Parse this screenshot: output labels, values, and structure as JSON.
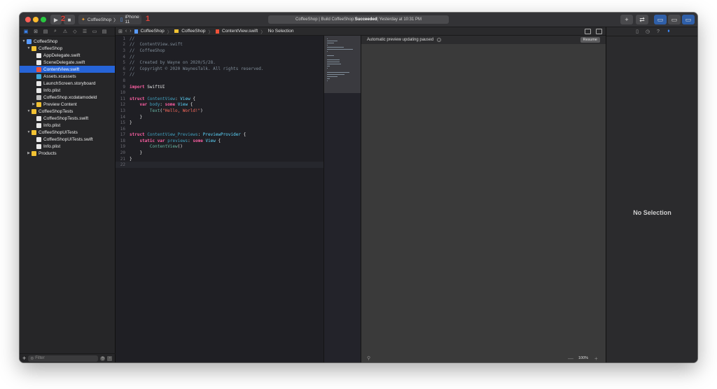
{
  "toolbar": {
    "marker_2": "2",
    "marker_1": "1",
    "scheme_name": "CoffeeShop",
    "scheme_sep": "〉",
    "device_name": "iPhone 11",
    "activity_prefix": "CoffeeShop | Build CoffeeShop: ",
    "activity_status": "Succeeded",
    "activity_suffix": " | Yesterday at 10:31 PM",
    "run_glyph": "▶",
    "stop_glyph": "■"
  },
  "navigator": {
    "items": [
      {
        "label": "CoffeeShop",
        "indent": 0,
        "disclosure": "▼",
        "icon": "proj"
      },
      {
        "label": "CoffeeShop",
        "indent": 1,
        "disclosure": "▼",
        "icon": "folder"
      },
      {
        "label": "AppDelegate.swift",
        "indent": 2,
        "disclosure": "",
        "icon": "file"
      },
      {
        "label": "SceneDelegate.swift",
        "indent": 2,
        "disclosure": "",
        "icon": "file"
      },
      {
        "label": "ContentView.swift",
        "indent": 2,
        "disclosure": "",
        "icon": "swift",
        "selected": true
      },
      {
        "label": "Assets.xcassets",
        "indent": 2,
        "disclosure": "",
        "icon": "assets"
      },
      {
        "label": "LaunchScreen.storyboard",
        "indent": 2,
        "disclosure": "",
        "icon": "file"
      },
      {
        "label": "Info.plist",
        "indent": 2,
        "disclosure": "",
        "icon": "file"
      },
      {
        "label": "CoffeeShop.xcdatamodeld",
        "indent": 2,
        "disclosure": "",
        "icon": "data"
      },
      {
        "label": "Preview Content",
        "indent": 2,
        "disclosure": "▶",
        "icon": "folder"
      },
      {
        "label": "CoffeeShopTests",
        "indent": 1,
        "disclosure": "▼",
        "icon": "folder"
      },
      {
        "label": "CoffeeShopTests.swift",
        "indent": 2,
        "disclosure": "",
        "icon": "file"
      },
      {
        "label": "Info.plist",
        "indent": 2,
        "disclosure": "",
        "icon": "file"
      },
      {
        "label": "CoffeeShopUITests",
        "indent": 1,
        "disclosure": "▼",
        "icon": "folder"
      },
      {
        "label": "CoffeeShopUITests.swift",
        "indent": 2,
        "disclosure": "",
        "icon": "file"
      },
      {
        "label": "Info.plist",
        "indent": 2,
        "disclosure": "",
        "icon": "file"
      },
      {
        "label": "Products",
        "indent": 1,
        "disclosure": "▶",
        "icon": "folder"
      }
    ],
    "filter_placeholder": "Filter",
    "add_glyph": "+"
  },
  "jumpbar": {
    "project": "CoffeeShop",
    "group": "CoffeeShop",
    "file": "ContentView.swift",
    "symbol": "No Selection",
    "sep": "〉"
  },
  "editor": {
    "lines": [
      [
        {
          "t": "//",
          "c": "c-comment"
        }
      ],
      [
        {
          "t": "//  ContentView.swift",
          "c": "c-comment"
        }
      ],
      [
        {
          "t": "//  CoffeeShop",
          "c": "c-comment"
        }
      ],
      [
        {
          "t": "//",
          "c": "c-comment"
        }
      ],
      [
        {
          "t": "//  Created by Wayne on 2020/5/28.",
          "c": "c-comment"
        }
      ],
      [
        {
          "t": "//  Copyright © 2020 WaynesTalk. All rights reserved.",
          "c": "c-comment"
        }
      ],
      [
        {
          "t": "//",
          "c": "c-comment"
        }
      ],
      [],
      [
        {
          "t": "import",
          "c": "c-kw"
        },
        {
          "t": " SwiftUI",
          "c": ""
        }
      ],
      [],
      [
        {
          "t": "struct",
          "c": "c-kw"
        },
        {
          "t": " ",
          "c": ""
        },
        {
          "t": "ContentView",
          "c": "c-decl"
        },
        {
          "t": ": ",
          "c": ""
        },
        {
          "t": "View",
          "c": "c-type"
        },
        {
          "t": " {",
          "c": ""
        }
      ],
      [
        {
          "t": "    ",
          "c": ""
        },
        {
          "t": "var",
          "c": "c-kw"
        },
        {
          "t": " ",
          "c": ""
        },
        {
          "t": "body",
          "c": "c-decl"
        },
        {
          "t": ": ",
          "c": ""
        },
        {
          "t": "some",
          "c": "c-kw"
        },
        {
          "t": " ",
          "c": ""
        },
        {
          "t": "View",
          "c": "c-type"
        },
        {
          "t": " {",
          "c": ""
        }
      ],
      [
        {
          "t": "        ",
          "c": ""
        },
        {
          "t": "Text",
          "c": "c-call"
        },
        {
          "t": "(",
          "c": ""
        },
        {
          "t": "\"Hello, World!\"",
          "c": "c-str"
        },
        {
          "t": ")",
          "c": ""
        }
      ],
      [
        {
          "t": "    }",
          "c": ""
        }
      ],
      [
        {
          "t": "}",
          "c": ""
        }
      ],
      [],
      [
        {
          "t": "struct",
          "c": "c-kw"
        },
        {
          "t": " ",
          "c": ""
        },
        {
          "t": "ContentView_Previews",
          "c": "c-decl"
        },
        {
          "t": ": ",
          "c": ""
        },
        {
          "t": "PreviewProvider",
          "c": "c-type"
        },
        {
          "t": " {",
          "c": ""
        }
      ],
      [
        {
          "t": "    ",
          "c": ""
        },
        {
          "t": "static",
          "c": "c-kw"
        },
        {
          "t": " ",
          "c": ""
        },
        {
          "t": "var",
          "c": "c-kw"
        },
        {
          "t": " ",
          "c": ""
        },
        {
          "t": "previews",
          "c": "c-decl"
        },
        {
          "t": ": ",
          "c": ""
        },
        {
          "t": "some",
          "c": "c-kw"
        },
        {
          "t": " ",
          "c": ""
        },
        {
          "t": "View",
          "c": "c-type"
        },
        {
          "t": " {",
          "c": ""
        }
      ],
      [
        {
          "t": "        ",
          "c": ""
        },
        {
          "t": "ContentView",
          "c": "c-call"
        },
        {
          "t": "()",
          "c": ""
        }
      ],
      [
        {
          "t": "    }",
          "c": ""
        }
      ],
      [
        {
          "t": "}",
          "c": ""
        }
      ],
      []
    ],
    "current_line": 22
  },
  "canvas": {
    "status": "Automatic preview updating paused",
    "resume_label": "Resume",
    "zoom": "100%",
    "zoom_minus": "—",
    "zoom_plus": "+"
  },
  "inspector": {
    "empty_label": "No Selection"
  },
  "colors": {
    "accent": "#2664d8",
    "error_marker": "#e0433a",
    "swift_orange": "#f05138",
    "folder_yellow": "#f2c233"
  }
}
